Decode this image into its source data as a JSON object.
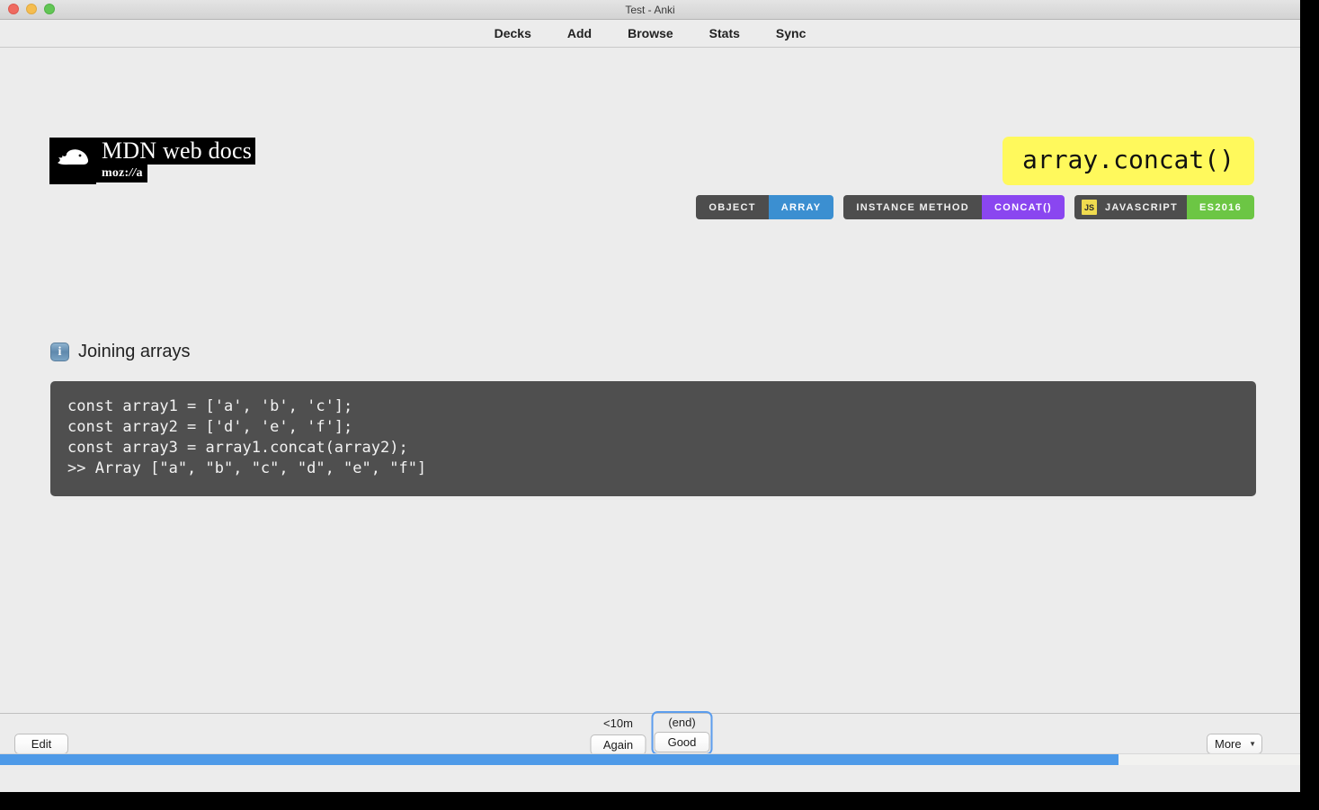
{
  "window": {
    "title": "Test - Anki",
    "traffic_lights": [
      "close-red",
      "minimize-yellow",
      "zoom-green"
    ]
  },
  "nav": {
    "items": [
      {
        "label": "Decks"
      },
      {
        "label": "Add"
      },
      {
        "label": "Browse"
      },
      {
        "label": "Stats"
      },
      {
        "label": "Sync"
      }
    ]
  },
  "card": {
    "logo": {
      "icon": "mdn-dino-icon",
      "title": "MDN web docs",
      "sub_pre": "moz:",
      "sub_em": "//",
      "sub_post": "a"
    },
    "title_chip": "array.concat()",
    "tags": [
      {
        "label": "OBJECT",
        "style": "dark"
      },
      {
        "label": "ARRAY",
        "style": "blue"
      },
      {
        "label": "INSTANCE METHOD",
        "style": "dark"
      },
      {
        "label": "CONCAT()",
        "style": "purple"
      },
      {
        "label": "JAVASCRIPT",
        "style": "dark",
        "icon": "js-icon",
        "icon_label": "JS"
      },
      {
        "label": "ES2016",
        "style": "green"
      }
    ],
    "section": {
      "icon": "info-icon",
      "icon_glyph": "i",
      "title": "Joining arrays"
    },
    "code": "const array1 = ['a', 'b', 'c'];\nconst array2 = ['d', 'e', 'f'];\nconst array3 = array1.concat(array2);\n>> Array [\"a\", \"b\", \"c\", \"d\", \"e\", \"f\"]"
  },
  "bottom": {
    "edit_label": "Edit",
    "more_label": "More",
    "more_caret": "▼",
    "answers": [
      {
        "interval": "<10m",
        "label": "Again",
        "focused": false
      },
      {
        "interval": "(end)",
        "label": "Good",
        "focused": true
      }
    ]
  },
  "progress": {
    "percent": 86
  },
  "colors": {
    "accent_blue": "#4e9ae8",
    "tag_blue": "#3b8fd1",
    "tag_purple": "#8a46f0",
    "tag_green": "#6cc644",
    "tag_dark": "#4d4d4d",
    "title_chip_bg": "#fff95c",
    "code_bg": "#4f4f4f",
    "js_yellow": "#f0db4f"
  }
}
